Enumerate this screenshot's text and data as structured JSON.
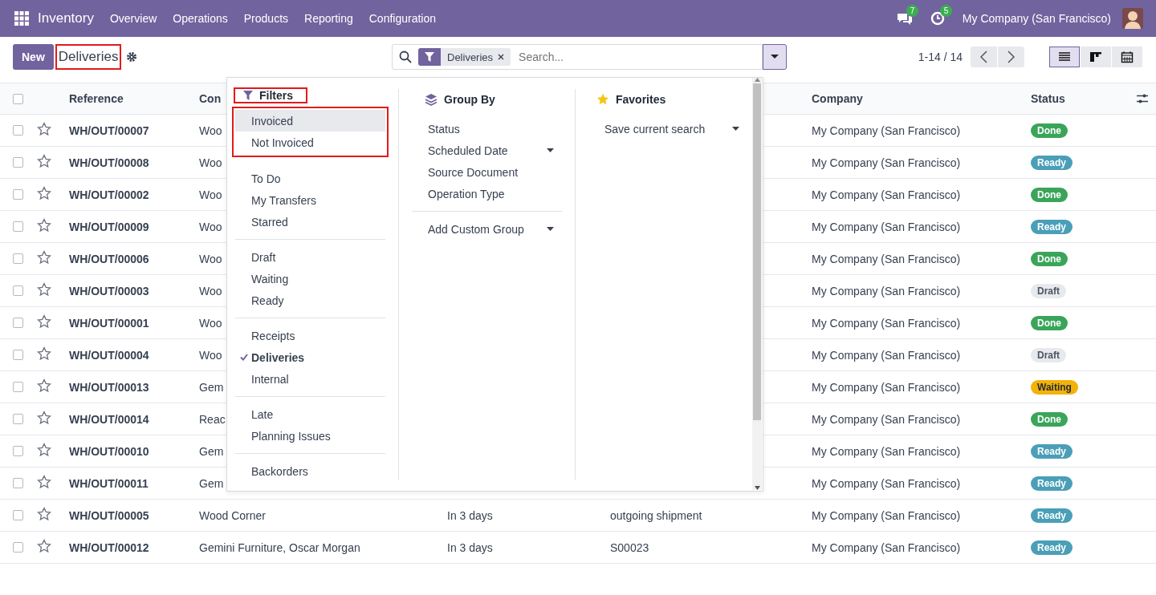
{
  "navbar": {
    "app_name": "Inventory",
    "menu": [
      "Overview",
      "Operations",
      "Products",
      "Reporting",
      "Configuration"
    ],
    "messages_count": "7",
    "activities_count": "5",
    "company": "My Company (San Francisco)"
  },
  "control_panel": {
    "new_button": "New",
    "title": "Deliveries",
    "title_highlighted": true,
    "search": {
      "facet": "Deliveries",
      "placeholder": "Search..."
    },
    "pager": "1-14 / 14",
    "views": [
      {
        "kind": "list",
        "selected": true
      },
      {
        "kind": "kanban",
        "selected": false
      },
      {
        "kind": "calendar",
        "selected": false
      }
    ]
  },
  "table": {
    "all_checked": false,
    "columns": {
      "reference": "Reference",
      "column_2": "Con",
      "company": "Company",
      "status": "Status"
    },
    "rows": [
      {
        "checked": false,
        "reference": "WH/OUT/00007",
        "contact": "Woo",
        "company": "My Company (San Francisco)",
        "status": {
          "label": "Done",
          "kind": "done"
        }
      },
      {
        "checked": false,
        "reference": "WH/OUT/00008",
        "contact": "Woo",
        "company": "My Company (San Francisco)",
        "status": {
          "label": "Ready",
          "kind": "ready"
        }
      },
      {
        "checked": false,
        "reference": "WH/OUT/00002",
        "contact": "Woo",
        "company": "My Company (San Francisco)",
        "status": {
          "label": "Done",
          "kind": "done"
        }
      },
      {
        "checked": false,
        "reference": "WH/OUT/00009",
        "contact": "Woo",
        "company": "My Company (San Francisco)",
        "status": {
          "label": "Ready",
          "kind": "ready"
        }
      },
      {
        "checked": false,
        "reference": "WH/OUT/00006",
        "contact": "Woo",
        "company": "My Company (San Francisco)",
        "status": {
          "label": "Done",
          "kind": "done"
        }
      },
      {
        "checked": false,
        "reference": "WH/OUT/00003",
        "contact": "Woo",
        "company": "My Company (San Francisco)",
        "status": {
          "label": "Draft",
          "kind": "draft"
        }
      },
      {
        "checked": false,
        "reference": "WH/OUT/00001",
        "contact": "Woo",
        "company": "My Company (San Francisco)",
        "status": {
          "label": "Done",
          "kind": "done"
        }
      },
      {
        "checked": false,
        "reference": "WH/OUT/00004",
        "contact": "Woo",
        "company": "My Company (San Francisco)",
        "status": {
          "label": "Draft",
          "kind": "draft"
        }
      },
      {
        "checked": false,
        "reference": "WH/OUT/00013",
        "contact": "Gem",
        "company": "My Company (San Francisco)",
        "status": {
          "label": "Waiting",
          "kind": "waiting"
        }
      },
      {
        "checked": false,
        "reference": "WH/OUT/00014",
        "contact": "Reac",
        "company": "My Company (San Francisco)",
        "status": {
          "label": "Done",
          "kind": "done"
        }
      },
      {
        "checked": false,
        "reference": "WH/OUT/00010",
        "contact": "Gem",
        "company": "My Company (San Francisco)",
        "status": {
          "label": "Ready",
          "kind": "ready"
        }
      },
      {
        "checked": false,
        "reference": "WH/OUT/00011",
        "contact": "Gem",
        "company": "My Company (San Francisco)",
        "status": {
          "label": "Ready",
          "kind": "ready"
        }
      },
      {
        "checked": false,
        "reference": "WH/OUT/00005",
        "contact": "Wood Corner",
        "column_3": "In 3 days",
        "column_4": "outgoing shipment",
        "company": "My Company (San Francisco)",
        "status": {
          "label": "Ready",
          "kind": "ready"
        }
      },
      {
        "checked": false,
        "reference": "WH/OUT/00012",
        "contact": "Gemini Furniture, Oscar Morgan",
        "column_3": "In 3 days",
        "column_4": "S00023",
        "company": "My Company (San Francisco)",
        "status": {
          "label": "Ready",
          "kind": "ready"
        }
      }
    ]
  },
  "search_panel": {
    "filters": {
      "title": "Filters",
      "highlighted": true,
      "groups": [
        {
          "highlighted": true,
          "items": [
            {
              "label": "Invoiced",
              "checked": false,
              "hovered": true
            },
            {
              "label": "Not Invoiced",
              "checked": false,
              "hovered": false
            }
          ]
        },
        {
          "highlighted": false,
          "items": [
            {
              "label": "To Do",
              "checked": false,
              "hovered": false
            },
            {
              "label": "My Transfers",
              "checked": false,
              "hovered": false
            },
            {
              "label": "Starred",
              "checked": false,
              "hovered": false
            }
          ]
        },
        {
          "highlighted": false,
          "items": [
            {
              "label": "Draft",
              "checked": false,
              "hovered": false
            },
            {
              "label": "Waiting",
              "checked": false,
              "hovered": false
            },
            {
              "label": "Ready",
              "checked": false,
              "hovered": false
            }
          ]
        },
        {
          "highlighted": false,
          "items": [
            {
              "label": "Receipts",
              "checked": false,
              "hovered": false
            },
            {
              "label": "Deliveries",
              "checked": true,
              "hovered": false
            },
            {
              "label": "Internal",
              "checked": false,
              "hovered": false
            }
          ]
        },
        {
          "highlighted": false,
          "items": [
            {
              "label": "Late",
              "checked": false,
              "hovered": false
            },
            {
              "label": "Planning Issues",
              "checked": false,
              "hovered": false
            }
          ]
        },
        {
          "highlighted": false,
          "items": [
            {
              "label": "Backorders",
              "checked": false,
              "hovered": false
            }
          ]
        }
      ]
    },
    "group_by": {
      "title": "Group By",
      "options": [
        {
          "label": "Status",
          "has_submenu": false
        },
        {
          "label": "Scheduled Date",
          "has_submenu": true
        },
        {
          "label": "Source Document",
          "has_submenu": false
        },
        {
          "label": "Operation Type",
          "has_submenu": false
        }
      ],
      "custom_group": "Add Custom Group"
    },
    "favorites": {
      "title": "Favorites",
      "save_search": "Save current search"
    }
  }
}
